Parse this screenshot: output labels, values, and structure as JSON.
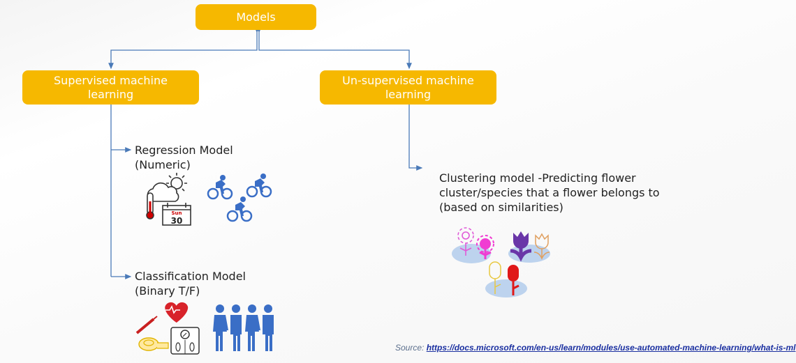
{
  "diagram": {
    "root": {
      "label": "Models"
    },
    "branches": [
      {
        "label": "Supervised machine learning",
        "children": [
          {
            "label_line1": "Regression Model",
            "label_line2": "(Numeric)",
            "illustration": [
              "weather-thermometer-calendar-icon",
              "cyclists-icon"
            ],
            "calendar_day": "Sun",
            "calendar_date": "30"
          },
          {
            "label_line1": "Classification Model",
            "label_line2": "(Binary T/F)",
            "illustration": [
              "health-metrics-icon",
              "people-group-icon"
            ]
          }
        ]
      },
      {
        "label": "Un-supervised machine learning",
        "children": [
          {
            "label": "Clustering model -Predicting flower cluster/species that a flower belongs to (based on similarities)",
            "illustration": [
              "flower-clusters-icon"
            ]
          }
        ]
      }
    ],
    "colors": {
      "box": "#F6B800",
      "connector": "#4A7AB8",
      "box_text": "#FFFFFF"
    }
  },
  "source": {
    "prefix": "Source:",
    "url": "https://docs.microsoft.com/en-us/learn/modules/use-automated-machine-learning/what-is-ml"
  }
}
